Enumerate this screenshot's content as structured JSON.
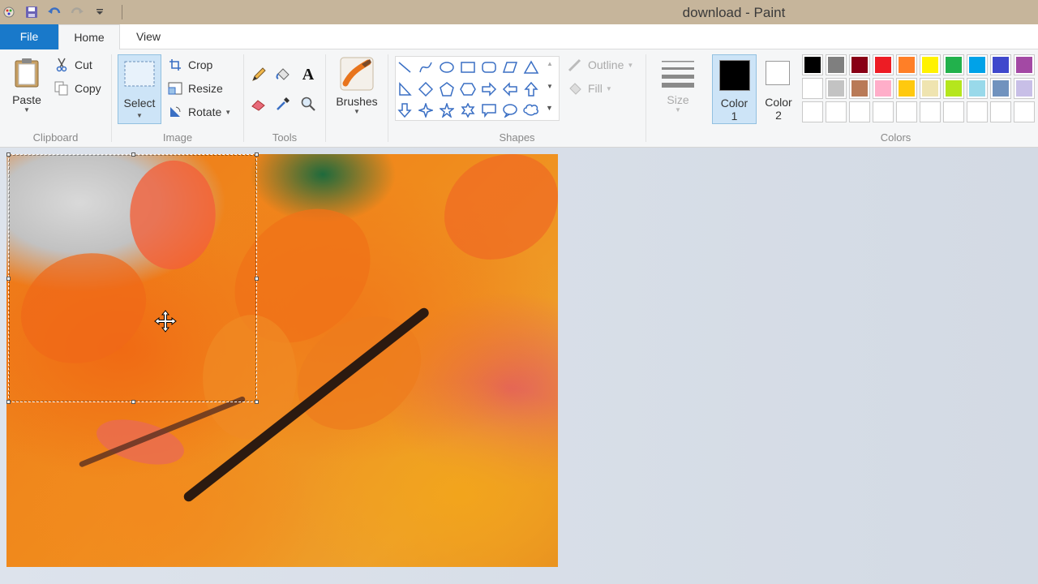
{
  "window": {
    "title": "download - Paint"
  },
  "tabs": {
    "file": "File",
    "home": "Home",
    "view": "View"
  },
  "clipboard": {
    "paste": "Paste",
    "cut": "Cut",
    "copy": "Copy",
    "label": "Clipboard"
  },
  "image": {
    "select": "Select",
    "crop": "Crop",
    "resize": "Resize",
    "rotate": "Rotate",
    "label": "Image"
  },
  "tools": {
    "label": "Tools"
  },
  "brushes": {
    "label": "Brushes"
  },
  "shapes": {
    "outline": "Outline",
    "fill": "Fill",
    "label": "Shapes"
  },
  "size": {
    "label": "Size"
  },
  "colors": {
    "color1_line1": "Color",
    "color1_line2": "1",
    "color2_line1": "Color",
    "color2_line2": "2",
    "label": "Colors",
    "color1_value": "#000000",
    "color2_value": "#ffffff",
    "palette_row1": [
      "#000000",
      "#7f7f7f",
      "#880015",
      "#ed1c24",
      "#ff7f27",
      "#fff200",
      "#22b14c",
      "#00a2e8",
      "#3f48cc",
      "#a349a4"
    ],
    "palette_row2": [
      "#ffffff",
      "#c3c3c3",
      "#b97a57",
      "#ffaec9",
      "#ffc90e",
      "#efe4b0",
      "#b5e61d",
      "#99d9ea",
      "#7092be",
      "#c8bfe7"
    ]
  }
}
